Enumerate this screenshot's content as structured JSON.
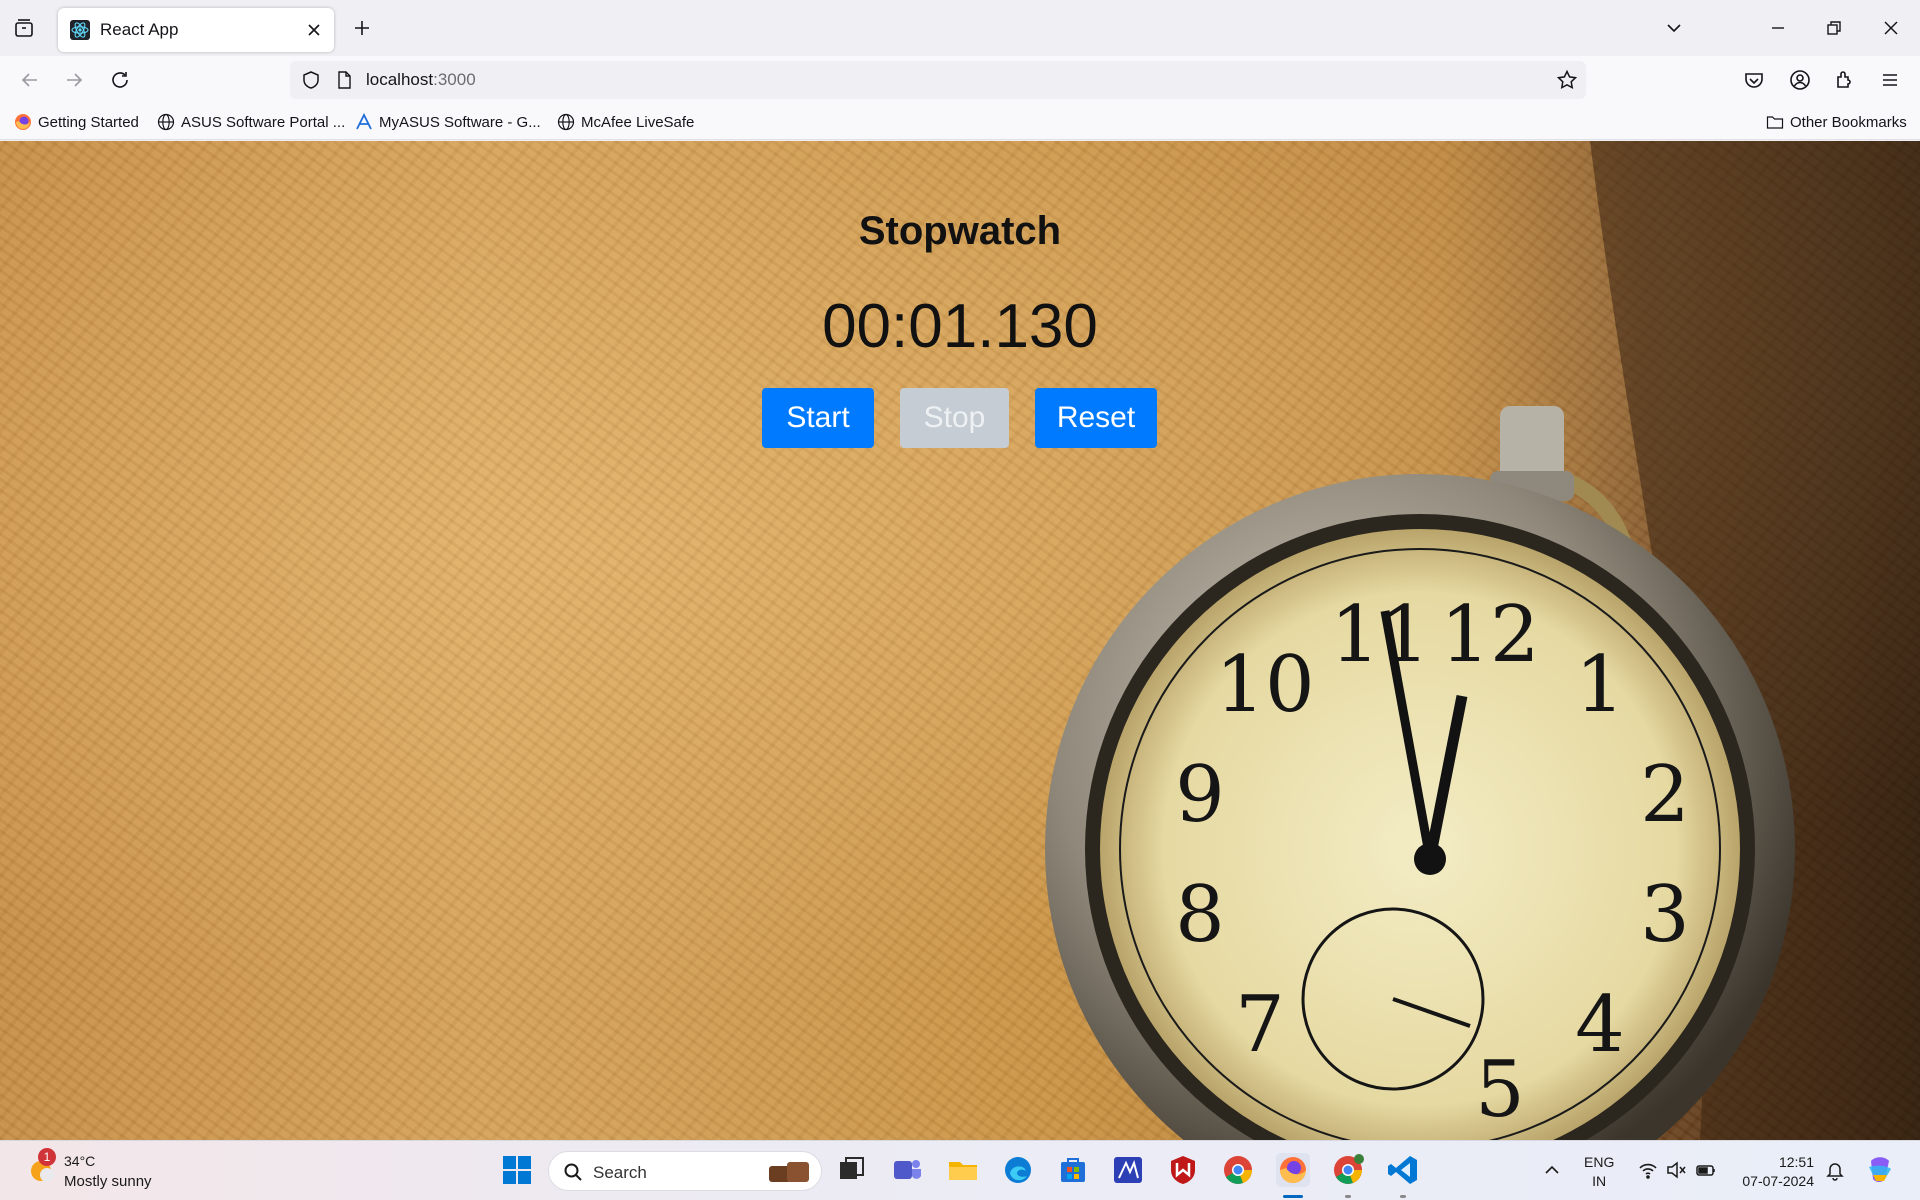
{
  "browser": {
    "tab_title": "React App",
    "url_host": "localhost",
    "url_port": ":3000",
    "bookmarks": [
      "Getting Started",
      "ASUS Software Portal ...",
      "MyASUS Software - G...",
      "McAfee LiveSafe"
    ],
    "other_bookmarks": "Other Bookmarks"
  },
  "app": {
    "title": "Stopwatch",
    "time": "00:01.130",
    "buttons": {
      "start": "Start",
      "stop": "Stop",
      "reset": "Reset"
    },
    "stop_disabled": true
  },
  "taskbar": {
    "weather_badge": "1",
    "temperature": "34°C",
    "condition": "Mostly sunny",
    "search_label": "Search",
    "language_line1": "ENG",
    "language_line2": "IN",
    "time": "12:51",
    "date": "07-07-2024"
  },
  "colors": {
    "accent": "#007bff",
    "disabled": "#c6ccd3"
  }
}
